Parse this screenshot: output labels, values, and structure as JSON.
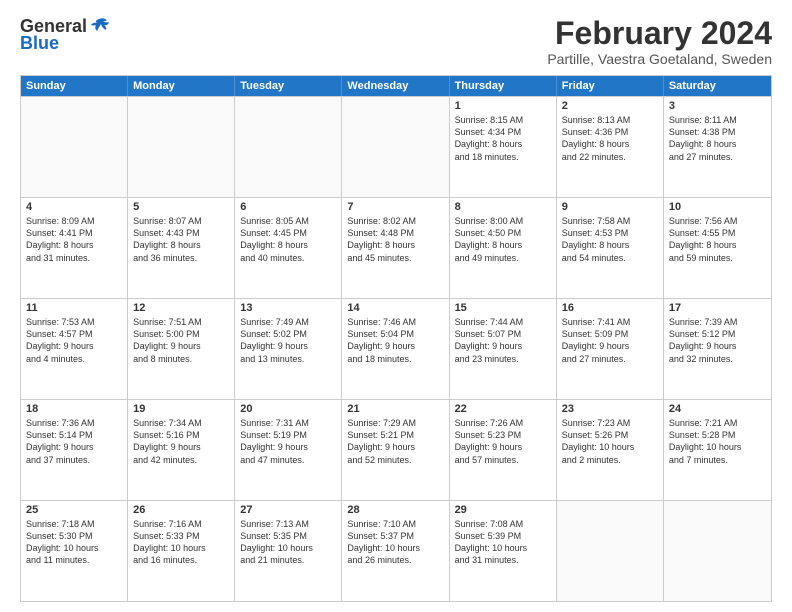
{
  "header": {
    "logo_general": "General",
    "logo_blue": "Blue",
    "main_title": "February 2024",
    "subtitle": "Partille, Vaestra Goetaland, Sweden"
  },
  "days": [
    "Sunday",
    "Monday",
    "Tuesday",
    "Wednesday",
    "Thursday",
    "Friday",
    "Saturday"
  ],
  "weeks": [
    [
      {
        "day": "",
        "content": ""
      },
      {
        "day": "",
        "content": ""
      },
      {
        "day": "",
        "content": ""
      },
      {
        "day": "",
        "content": ""
      },
      {
        "day": "1",
        "content": "Sunrise: 8:15 AM\nSunset: 4:34 PM\nDaylight: 8 hours\nand 18 minutes."
      },
      {
        "day": "2",
        "content": "Sunrise: 8:13 AM\nSunset: 4:36 PM\nDaylight: 8 hours\nand 22 minutes."
      },
      {
        "day": "3",
        "content": "Sunrise: 8:11 AM\nSunset: 4:38 PM\nDaylight: 8 hours\nand 27 minutes."
      }
    ],
    [
      {
        "day": "4",
        "content": "Sunrise: 8:09 AM\nSunset: 4:41 PM\nDaylight: 8 hours\nand 31 minutes."
      },
      {
        "day": "5",
        "content": "Sunrise: 8:07 AM\nSunset: 4:43 PM\nDaylight: 8 hours\nand 36 minutes."
      },
      {
        "day": "6",
        "content": "Sunrise: 8:05 AM\nSunset: 4:45 PM\nDaylight: 8 hours\nand 40 minutes."
      },
      {
        "day": "7",
        "content": "Sunrise: 8:02 AM\nSunset: 4:48 PM\nDaylight: 8 hours\nand 45 minutes."
      },
      {
        "day": "8",
        "content": "Sunrise: 8:00 AM\nSunset: 4:50 PM\nDaylight: 8 hours\nand 49 minutes."
      },
      {
        "day": "9",
        "content": "Sunrise: 7:58 AM\nSunset: 4:53 PM\nDaylight: 8 hours\nand 54 minutes."
      },
      {
        "day": "10",
        "content": "Sunrise: 7:56 AM\nSunset: 4:55 PM\nDaylight: 8 hours\nand 59 minutes."
      }
    ],
    [
      {
        "day": "11",
        "content": "Sunrise: 7:53 AM\nSunset: 4:57 PM\nDaylight: 9 hours\nand 4 minutes."
      },
      {
        "day": "12",
        "content": "Sunrise: 7:51 AM\nSunset: 5:00 PM\nDaylight: 9 hours\nand 8 minutes."
      },
      {
        "day": "13",
        "content": "Sunrise: 7:49 AM\nSunset: 5:02 PM\nDaylight: 9 hours\nand 13 minutes."
      },
      {
        "day": "14",
        "content": "Sunrise: 7:46 AM\nSunset: 5:04 PM\nDaylight: 9 hours\nand 18 minutes."
      },
      {
        "day": "15",
        "content": "Sunrise: 7:44 AM\nSunset: 5:07 PM\nDaylight: 9 hours\nand 23 minutes."
      },
      {
        "day": "16",
        "content": "Sunrise: 7:41 AM\nSunset: 5:09 PM\nDaylight: 9 hours\nand 27 minutes."
      },
      {
        "day": "17",
        "content": "Sunrise: 7:39 AM\nSunset: 5:12 PM\nDaylight: 9 hours\nand 32 minutes."
      }
    ],
    [
      {
        "day": "18",
        "content": "Sunrise: 7:36 AM\nSunset: 5:14 PM\nDaylight: 9 hours\nand 37 minutes."
      },
      {
        "day": "19",
        "content": "Sunrise: 7:34 AM\nSunset: 5:16 PM\nDaylight: 9 hours\nand 42 minutes."
      },
      {
        "day": "20",
        "content": "Sunrise: 7:31 AM\nSunset: 5:19 PM\nDaylight: 9 hours\nand 47 minutes."
      },
      {
        "day": "21",
        "content": "Sunrise: 7:29 AM\nSunset: 5:21 PM\nDaylight: 9 hours\nand 52 minutes."
      },
      {
        "day": "22",
        "content": "Sunrise: 7:26 AM\nSunset: 5:23 PM\nDaylight: 9 hours\nand 57 minutes."
      },
      {
        "day": "23",
        "content": "Sunrise: 7:23 AM\nSunset: 5:26 PM\nDaylight: 10 hours\nand 2 minutes."
      },
      {
        "day": "24",
        "content": "Sunrise: 7:21 AM\nSunset: 5:28 PM\nDaylight: 10 hours\nand 7 minutes."
      }
    ],
    [
      {
        "day": "25",
        "content": "Sunrise: 7:18 AM\nSunset: 5:30 PM\nDaylight: 10 hours\nand 11 minutes."
      },
      {
        "day": "26",
        "content": "Sunrise: 7:16 AM\nSunset: 5:33 PM\nDaylight: 10 hours\nand 16 minutes."
      },
      {
        "day": "27",
        "content": "Sunrise: 7:13 AM\nSunset: 5:35 PM\nDaylight: 10 hours\nand 21 minutes."
      },
      {
        "day": "28",
        "content": "Sunrise: 7:10 AM\nSunset: 5:37 PM\nDaylight: 10 hours\nand 26 minutes."
      },
      {
        "day": "29",
        "content": "Sunrise: 7:08 AM\nSunset: 5:39 PM\nDaylight: 10 hours\nand 31 minutes."
      },
      {
        "day": "",
        "content": ""
      },
      {
        "day": "",
        "content": ""
      }
    ]
  ]
}
